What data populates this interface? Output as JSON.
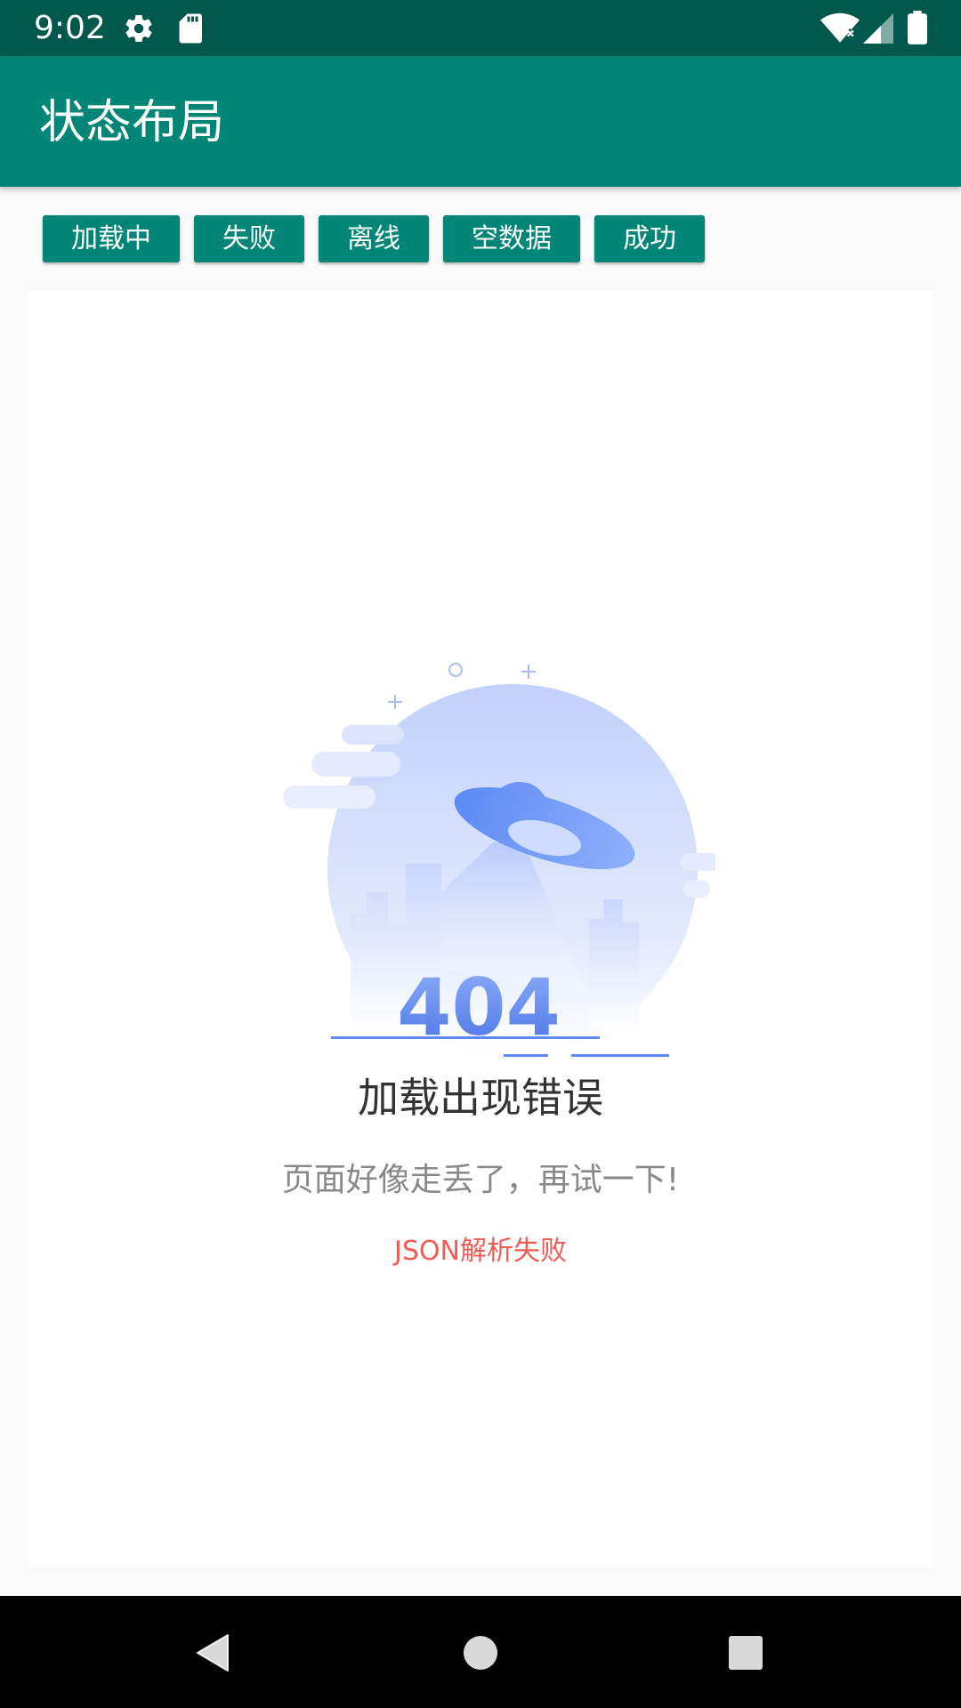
{
  "status_bar": {
    "time": "9:02",
    "icons": [
      "settings-icon",
      "sd-card-icon",
      "wifi-icon",
      "cellular-signal-icon",
      "battery-icon"
    ]
  },
  "app_bar": {
    "title": "状态布局"
  },
  "toolbar": {
    "buttons": [
      {
        "label": "加载中"
      },
      {
        "label": "失败"
      },
      {
        "label": "离线"
      },
      {
        "label": "空数据"
      },
      {
        "label": "成功"
      }
    ]
  },
  "error_state": {
    "illustration_code": "404",
    "title": "加载出现错误",
    "subtitle": "页面好像走丢了，再试一下!",
    "detail": "JSON解析失败"
  },
  "navigation": {
    "icons": [
      "back-icon",
      "home-icon",
      "recents-icon"
    ]
  },
  "colors": {
    "primary": "#008577",
    "primary_dark": "#00574b",
    "error_text": "#f25a54",
    "illustration_blue": "#5b8af5"
  }
}
